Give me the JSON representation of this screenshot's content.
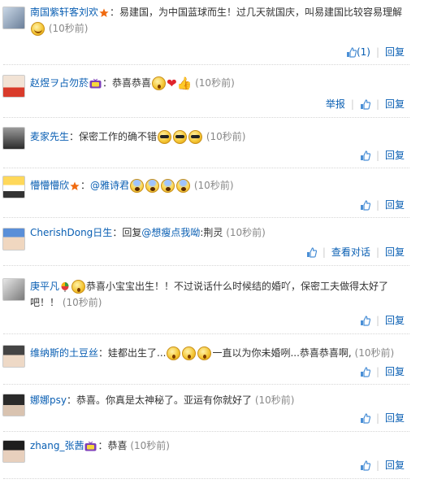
{
  "actions": {
    "reply": "回复",
    "report": "举报",
    "view_conversation": "查看对话"
  },
  "colors": {
    "link": "#0a5fb3",
    "time": "#888888",
    "separator": "#d6d6d6"
  },
  "comments": [
    {
      "user": "南国紫轩客刘欢",
      "vip": "star",
      "text": "：易建国，为中国蓝球而生！过几天就国庆，叫易建国比较容易理解",
      "emoticons": [
        "blush"
      ],
      "time": "(10秒前)",
      "likes": "(1)",
      "show_report": false,
      "show_conversation": false
    },
    {
      "user": "赵煜ヲ占勿菸",
      "vip": "tv",
      "text": "：恭喜恭喜",
      "emoticons": [
        "surprise",
        "heart",
        "thumb"
      ],
      "time": "(10秒前)",
      "likes": "",
      "show_report": true,
      "show_conversation": false
    },
    {
      "user": "麦家先生",
      "vip": "",
      "text": "：保密工作的确不错",
      "emoticons": [
        "sunglasses",
        "sunglasses",
        "sunglasses"
      ],
      "time": "(10秒前)",
      "likes": "",
      "show_report": false,
      "show_conversation": false
    },
    {
      "user": "懵懵懵欣",
      "vip": "star",
      "text": "：",
      "mention": "@雅诗君",
      "emoticons": [
        "fear",
        "fear",
        "fear",
        "fear"
      ],
      "time": "(10秒前)",
      "likes": "",
      "show_report": false,
      "show_conversation": false
    },
    {
      "user": "CherishDong日生",
      "vip": "",
      "text": "：回复",
      "mention": "@想瘦点我呦",
      "text_after": ":荆灵",
      "emoticons": [],
      "time": "(10秒前)",
      "likes": "",
      "show_report": false,
      "show_conversation": true
    },
    {
      "user": "庚平凡",
      "vip": "balloon",
      "text": "恭喜小宝宝出生！！不过说话什么时候结的婚吖，保密工夫做得太好了吧！！",
      "emoticons_before": [
        "surprise"
      ],
      "emoticons": [],
      "time": "(10秒前)",
      "likes": "",
      "show_report": false,
      "show_conversation": false
    },
    {
      "user": "维纳斯的土豆丝",
      "vip": "",
      "text": "：娃都出生了...",
      "emoticons": [
        "surprise",
        "surprise",
        "surprise"
      ],
      "text_after": "一直以为你未婚咧...恭喜恭喜啊,",
      "time": "(10秒前)",
      "likes": "",
      "show_report": false,
      "show_conversation": false
    },
    {
      "user": "娜娜psy",
      "vip": "",
      "text": "：恭喜。你真是太神秘了。亚运有你就好了",
      "emoticons": [],
      "time": "(10秒前)",
      "likes": "",
      "show_report": false,
      "show_conversation": false
    },
    {
      "user": "zhang_张茜",
      "vip": "tv",
      "text": "：恭喜",
      "emoticons": [],
      "time": "(10秒前)",
      "likes": "",
      "show_report": false,
      "show_conversation": false
    }
  ]
}
